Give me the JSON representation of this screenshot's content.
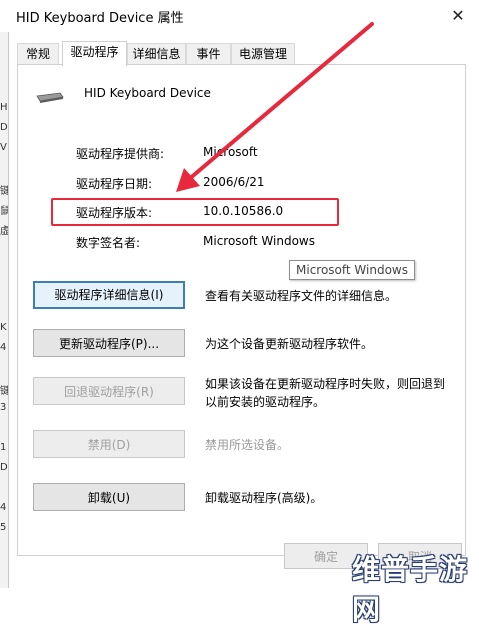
{
  "window": {
    "title": "HID Keyboard Device 属性",
    "close_glyph": "✕"
  },
  "tabs": [
    {
      "label": "常规"
    },
    {
      "label": "驱动程序"
    },
    {
      "label": "详细信息"
    },
    {
      "label": "事件"
    },
    {
      "label": "电源管理"
    }
  ],
  "device": {
    "name": "HID Keyboard Device",
    "icon": "keyboard-icon"
  },
  "info": {
    "provider_label": "驱动程序提供商:",
    "provider_value": "Microsoft",
    "date_label": "驱动程序日期:",
    "date_value": "2006/6/21",
    "version_label": "驱动程序版本:",
    "version_value": "10.0.10586.0",
    "signer_label": "数字签名者:",
    "signer_value": "Microsoft Windows"
  },
  "tooltip": "Microsoft Windows",
  "buttons": [
    {
      "label": "驱动程序详细信息(I)",
      "desc": "查看有关驱动程序文件的详细信息。"
    },
    {
      "label": "更新驱动程序(P)...",
      "desc": "为这个设备更新驱动程序软件。"
    },
    {
      "label": "回退驱动程序(R)",
      "desc_line1": "如果该设备在更新驱动程序时失败，则回退到",
      "desc_line2": "以前安装的驱动程序。"
    },
    {
      "label": "禁用(D)",
      "desc": "禁用所选设备。"
    },
    {
      "label": "卸载(U)",
      "desc": "卸载驱动程序(高级)。"
    }
  ],
  "footer": {
    "ok_label": "确定",
    "cancel_label": "取消"
  },
  "left_glyphs": [
    "H",
    "D",
    "V",
    "键",
    "鼠",
    "虚",
    "K",
    "4",
    "键",
    "3",
    "1",
    "D",
    "4",
    "5"
  ],
  "watermark": "维普手游网",
  "colors": {
    "highlight": "#e8283c",
    "arrow": "#e8283c",
    "primary_border": "#3c7fb1"
  }
}
